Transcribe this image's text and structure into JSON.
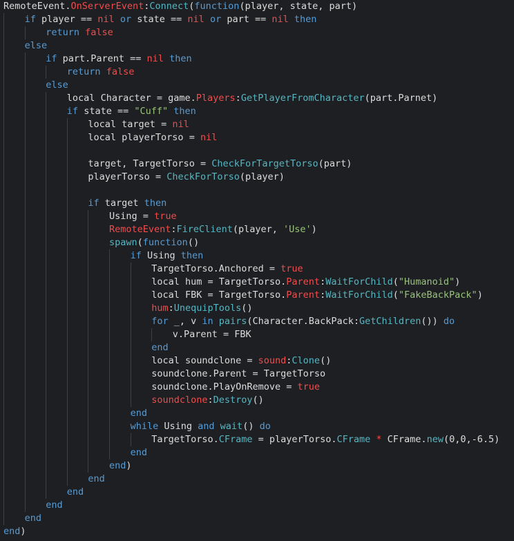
{
  "colors": {
    "background": "#1e1f22",
    "plain": "#dcdcdc",
    "keyword": "#569cd6",
    "literal": "#f14c4c",
    "string": "#98c379",
    "method": "#56b6c2",
    "indent_guide": "#3f3f46"
  },
  "lines": [
    {
      "indent": 0,
      "tokens": [
        [
          "plain",
          "RemoteEvent."
        ],
        [
          "red",
          "OnServerEvent"
        ],
        [
          "plain",
          ":"
        ],
        [
          "method",
          "Connect"
        ],
        [
          "plain",
          "("
        ],
        [
          "keyword",
          "function"
        ],
        [
          "plain",
          "(player, state, part)"
        ]
      ]
    },
    {
      "indent": 1,
      "tokens": [
        [
          "keyword",
          "if"
        ],
        [
          "plain",
          " player "
        ],
        [
          "plain",
          "=="
        ],
        [
          "plain",
          " "
        ],
        [
          "literal",
          "nil"
        ],
        [
          "plain",
          " "
        ],
        [
          "keyword",
          "or"
        ],
        [
          "plain",
          " state "
        ],
        [
          "plain",
          "=="
        ],
        [
          "plain",
          " "
        ],
        [
          "literal",
          "nil"
        ],
        [
          "plain",
          " "
        ],
        [
          "keyword",
          "or"
        ],
        [
          "plain",
          " part "
        ],
        [
          "plain",
          "=="
        ],
        [
          "plain",
          " "
        ],
        [
          "literal",
          "nil"
        ],
        [
          "plain",
          " "
        ],
        [
          "keyword",
          "then"
        ]
      ]
    },
    {
      "indent": 2,
      "tokens": [
        [
          "keyword",
          "return"
        ],
        [
          "plain",
          " "
        ],
        [
          "literal",
          "false"
        ]
      ]
    },
    {
      "indent": 1,
      "tokens": [
        [
          "keyword",
          "else"
        ]
      ]
    },
    {
      "indent": 2,
      "tokens": [
        [
          "keyword",
          "if"
        ],
        [
          "plain",
          " part.Parent "
        ],
        [
          "plain",
          "=="
        ],
        [
          "plain",
          " "
        ],
        [
          "literal",
          "nil"
        ],
        [
          "plain",
          " "
        ],
        [
          "keyword",
          "then"
        ]
      ]
    },
    {
      "indent": 3,
      "tokens": [
        [
          "keyword",
          "return"
        ],
        [
          "plain",
          " "
        ],
        [
          "literal",
          "false"
        ]
      ]
    },
    {
      "indent": 2,
      "tokens": [
        [
          "keyword",
          "else"
        ]
      ]
    },
    {
      "indent": 3,
      "tokens": [
        [
          "plain",
          "local Character "
        ],
        [
          "plain",
          "="
        ],
        [
          "plain",
          " game."
        ],
        [
          "red",
          "Players"
        ],
        [
          "plain",
          ":"
        ],
        [
          "method",
          "GetPlayerFromCharacter"
        ],
        [
          "plain",
          "(part.Parnet)"
        ]
      ]
    },
    {
      "indent": 3,
      "tokens": [
        [
          "keyword",
          "if"
        ],
        [
          "plain",
          " state "
        ],
        [
          "plain",
          "=="
        ],
        [
          "plain",
          " "
        ],
        [
          "string",
          "\"Cuff\""
        ],
        [
          "plain",
          " "
        ],
        [
          "keyword",
          "then"
        ]
      ]
    },
    {
      "indent": 4,
      "tokens": [
        [
          "plain",
          "local target "
        ],
        [
          "plain",
          "="
        ],
        [
          "plain",
          " "
        ],
        [
          "literal",
          "nil"
        ]
      ]
    },
    {
      "indent": 4,
      "tokens": [
        [
          "plain",
          "local playerTorso "
        ],
        [
          "plain",
          "="
        ],
        [
          "plain",
          " "
        ],
        [
          "literal",
          "nil"
        ]
      ]
    },
    {
      "indent": 4,
      "tokens": []
    },
    {
      "indent": 4,
      "tokens": [
        [
          "plain",
          "target, TargetTorso "
        ],
        [
          "plain",
          "="
        ],
        [
          "plain",
          " "
        ],
        [
          "method",
          "CheckForTargetTorso"
        ],
        [
          "plain",
          "(part)"
        ]
      ]
    },
    {
      "indent": 4,
      "tokens": [
        [
          "plain",
          "playerTorso "
        ],
        [
          "plain",
          "="
        ],
        [
          "plain",
          " "
        ],
        [
          "method",
          "CheckForTorso"
        ],
        [
          "plain",
          "(player)"
        ]
      ]
    },
    {
      "indent": 4,
      "tokens": []
    },
    {
      "indent": 4,
      "tokens": [
        [
          "keyword",
          "if"
        ],
        [
          "plain",
          " target "
        ],
        [
          "keyword",
          "then"
        ]
      ]
    },
    {
      "indent": 5,
      "tokens": [
        [
          "plain",
          "Using "
        ],
        [
          "plain",
          "="
        ],
        [
          "plain",
          " "
        ],
        [
          "literal",
          "true"
        ]
      ]
    },
    {
      "indent": 5,
      "tokens": [
        [
          "red",
          "RemoteEvent"
        ],
        [
          "plain",
          ":"
        ],
        [
          "method",
          "FireClient"
        ],
        [
          "plain",
          "(player, "
        ],
        [
          "string",
          "'Use'"
        ],
        [
          "plain",
          ")"
        ]
      ]
    },
    {
      "indent": 5,
      "tokens": [
        [
          "method",
          "spawn"
        ],
        [
          "plain",
          "("
        ],
        [
          "keyword",
          "function"
        ],
        [
          "plain",
          "()"
        ]
      ]
    },
    {
      "indent": 6,
      "tokens": [
        [
          "keyword",
          "if"
        ],
        [
          "plain",
          " Using "
        ],
        [
          "keyword",
          "then"
        ]
      ]
    },
    {
      "indent": 7,
      "tokens": [
        [
          "plain",
          "TargetTorso.Anchored "
        ],
        [
          "plain",
          "="
        ],
        [
          "plain",
          " "
        ],
        [
          "literal",
          "true"
        ]
      ]
    },
    {
      "indent": 7,
      "tokens": [
        [
          "plain",
          "local hum "
        ],
        [
          "plain",
          "="
        ],
        [
          "plain",
          " TargetTorso."
        ],
        [
          "red",
          "Parent"
        ],
        [
          "plain",
          ":"
        ],
        [
          "method",
          "WaitForChild"
        ],
        [
          "plain",
          "("
        ],
        [
          "string",
          "\"Humanoid\""
        ],
        [
          "plain",
          ")"
        ]
      ]
    },
    {
      "indent": 7,
      "tokens": [
        [
          "plain",
          "local FBK "
        ],
        [
          "plain",
          "="
        ],
        [
          "plain",
          " TargetTorso."
        ],
        [
          "red",
          "Parent"
        ],
        [
          "plain",
          ":"
        ],
        [
          "method",
          "WaitForChild"
        ],
        [
          "plain",
          "("
        ],
        [
          "string",
          "\"FakeBackPack\""
        ],
        [
          "plain",
          ")"
        ]
      ]
    },
    {
      "indent": 7,
      "tokens": [
        [
          "red",
          "hum"
        ],
        [
          "plain",
          ":"
        ],
        [
          "method",
          "UnequipTools"
        ],
        [
          "plain",
          "()"
        ]
      ]
    },
    {
      "indent": 7,
      "tokens": [
        [
          "keyword",
          "for"
        ],
        [
          "plain",
          " _, v "
        ],
        [
          "keyword",
          "in"
        ],
        [
          "plain",
          " "
        ],
        [
          "method",
          "pairs"
        ],
        [
          "plain",
          "(Character.BackPack:"
        ],
        [
          "method",
          "GetChildren"
        ],
        [
          "plain",
          "()) "
        ],
        [
          "keyword",
          "do"
        ]
      ]
    },
    {
      "indent": 8,
      "tokens": [
        [
          "plain",
          "v.Parent "
        ],
        [
          "plain",
          "="
        ],
        [
          "plain",
          " FBK"
        ]
      ]
    },
    {
      "indent": 7,
      "tokens": [
        [
          "keyword",
          "end"
        ]
      ]
    },
    {
      "indent": 7,
      "tokens": [
        [
          "plain",
          "local soundclone "
        ],
        [
          "plain",
          "="
        ],
        [
          "plain",
          " "
        ],
        [
          "red",
          "sound"
        ],
        [
          "plain",
          ":"
        ],
        [
          "method",
          "Clone"
        ],
        [
          "plain",
          "()"
        ]
      ]
    },
    {
      "indent": 7,
      "tokens": [
        [
          "plain",
          "soundclone.Parent "
        ],
        [
          "plain",
          "="
        ],
        [
          "plain",
          " TargetTorso"
        ]
      ]
    },
    {
      "indent": 7,
      "tokens": [
        [
          "plain",
          "soundclone.PlayOnRemove "
        ],
        [
          "plain",
          "="
        ],
        [
          "plain",
          " "
        ],
        [
          "literal",
          "true"
        ]
      ]
    },
    {
      "indent": 7,
      "tokens": [
        [
          "red",
          "soundclone"
        ],
        [
          "plain",
          ":"
        ],
        [
          "method",
          "Destroy"
        ],
        [
          "plain",
          "()"
        ]
      ]
    },
    {
      "indent": 6,
      "tokens": [
        [
          "keyword",
          "end"
        ]
      ]
    },
    {
      "indent": 6,
      "tokens": [
        [
          "keyword",
          "while"
        ],
        [
          "plain",
          " Using "
        ],
        [
          "keyword",
          "and"
        ],
        [
          "plain",
          " "
        ],
        [
          "method",
          "wait"
        ],
        [
          "plain",
          "() "
        ],
        [
          "keyword",
          "do"
        ]
      ]
    },
    {
      "indent": 7,
      "tokens": [
        [
          "plain",
          "TargetTorso."
        ],
        [
          "method",
          "CFrame"
        ],
        [
          "plain",
          " "
        ],
        [
          "plain",
          "="
        ],
        [
          "plain",
          " playerTorso."
        ],
        [
          "method",
          "CFrame"
        ],
        [
          "plain",
          " "
        ],
        [
          "red",
          "*"
        ],
        [
          "plain",
          " CFrame."
        ],
        [
          "method",
          "new"
        ],
        [
          "plain",
          "(0,0,-6.5)"
        ]
      ]
    },
    {
      "indent": 6,
      "tokens": [
        [
          "keyword",
          "end"
        ]
      ]
    },
    {
      "indent": 5,
      "tokens": [
        [
          "keyword",
          "end"
        ],
        [
          "plain",
          ")"
        ]
      ]
    },
    {
      "indent": 4,
      "tokens": [
        [
          "keyword",
          "end"
        ]
      ]
    },
    {
      "indent": 3,
      "tokens": [
        [
          "keyword",
          "end"
        ]
      ]
    },
    {
      "indent": 2,
      "tokens": [
        [
          "keyword",
          "end"
        ]
      ]
    },
    {
      "indent": 1,
      "tokens": [
        [
          "keyword",
          "end"
        ]
      ]
    },
    {
      "indent": 0,
      "tokens": [
        [
          "keyword",
          "end"
        ],
        [
          "plain",
          ")"
        ]
      ]
    }
  ]
}
